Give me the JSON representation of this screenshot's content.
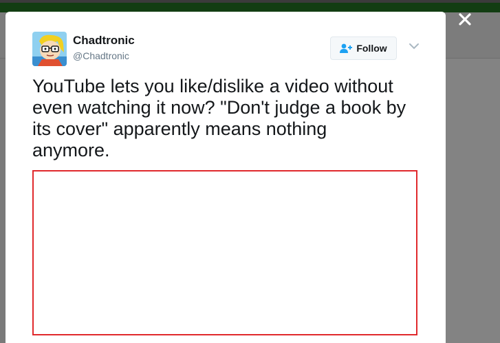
{
  "modal": {
    "user": {
      "name": "Chadtronic",
      "handle": "@Chadtronic"
    },
    "follow_label": "Follow",
    "tweet_text": "YouTube lets you like/dislike a video without\neven watching it now? \"Don't judge a book by\nits cover\" apparently means nothing\nanymore."
  },
  "icons": {
    "close": "close-icon",
    "follow": "add-user-icon",
    "chevron": "chevron-down-icon",
    "avatar": "cartoon-avatar"
  },
  "colors": {
    "media_border": "#e0282b",
    "header_green": "#123d12",
    "overlay": "#7a7a7a"
  }
}
